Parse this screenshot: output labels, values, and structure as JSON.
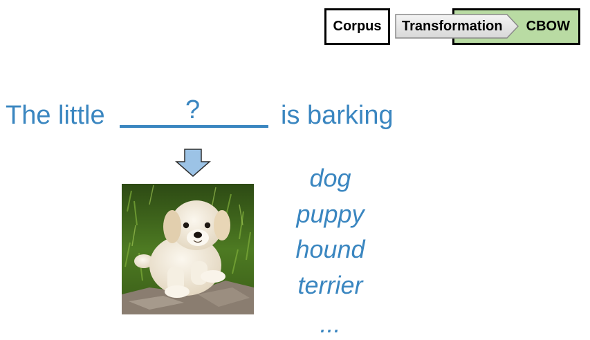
{
  "pipeline": {
    "corpus_label": "Corpus",
    "transformation_label": "Transformation",
    "cbow_label": "CBOW"
  },
  "sentence": {
    "before": "The little",
    "blank_mark": "?",
    "after": "is barking"
  },
  "candidates": [
    "dog",
    "puppy",
    "hound",
    "terrier",
    "..."
  ],
  "colors": {
    "text_blue": "#3a86c0",
    "arrow_fill": "#9cc3e6",
    "cbow_fill": "#b9dba3",
    "transform_fill": "#e6e6e6"
  },
  "icons": {
    "down_arrow": "down-arrow-icon",
    "image": "puppy-photo"
  }
}
